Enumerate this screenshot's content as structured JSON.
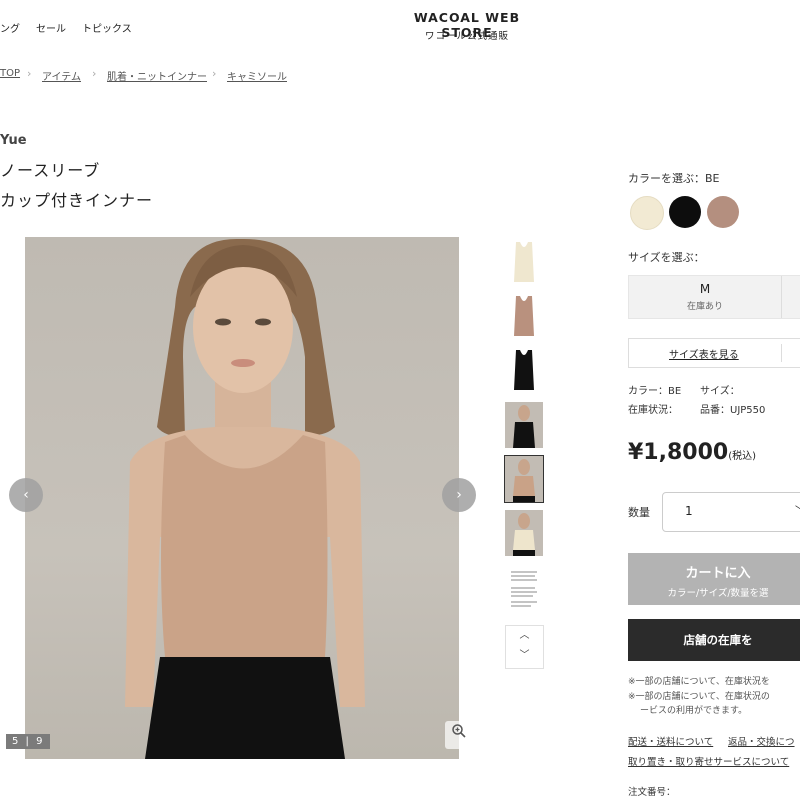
{
  "header": {
    "nav": [
      "ング",
      "セール",
      "トピックス"
    ],
    "logo": "WACOAL WEB STORE",
    "logo_sub": "ワコール公式通販"
  },
  "breadcrumb": [
    "TOP",
    "アイテム",
    "肌着・ニットインナー",
    "キャミソール"
  ],
  "product": {
    "brand": "Yue",
    "title_line1": "ノースリーブ",
    "title_line2": "カップ付きインナー"
  },
  "gallery": {
    "counter": "5 | 9",
    "prev_icon": "‹",
    "next_icon": "›",
    "zoom_icon": "zoom-icon",
    "thumb_up": "︿",
    "thumb_down": "﹀"
  },
  "panel": {
    "color_label": "カラーを選ぶ：BE",
    "colors": [
      "#f2ead3",
      "#0d0d0d",
      "#b48f7f"
    ],
    "size_label": "サイズを選ぶ：",
    "size": {
      "value": "M",
      "stock": "在庫あり"
    },
    "size_chart": "サイズ表を見る",
    "color_summary_label": "カラー：BE",
    "size_summary_label": "サイズ：",
    "stock_label": "在庫状況：",
    "sku_label": "品番：UJP550",
    "price": "¥1,8000",
    "price_tax": "(税込)",
    "qty_label": "数量",
    "qty_value": "1",
    "cart_main": "カートに入",
    "cart_sub": "カラー/サイズ/数量を選",
    "store_button": "店舗の在庫を",
    "note1": "※一部の店舗について、在庫状況を",
    "note2": "※一部の店舗について、在庫状況の",
    "note3": "ービスの利用ができます。",
    "link1": "配送・送料について",
    "link2": "返品・交換につ",
    "link3": "取り置き・取り寄せサービスについて",
    "order_label": "注文番号："
  }
}
